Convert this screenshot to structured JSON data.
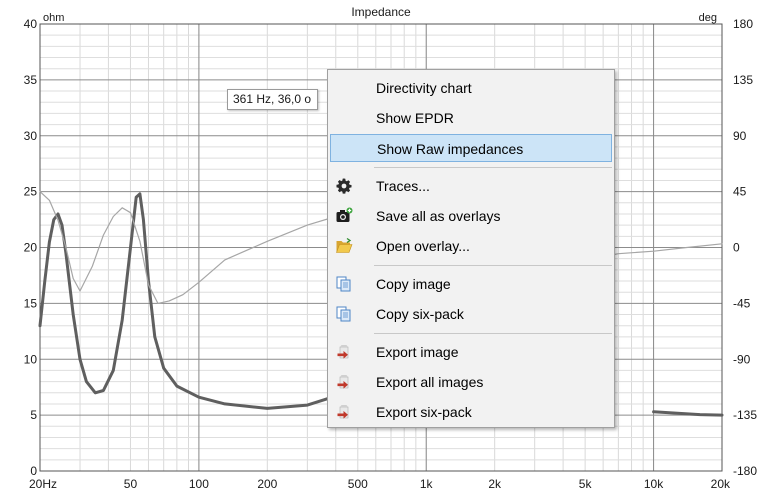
{
  "chart_data": {
    "type": "line",
    "title": "Impedance",
    "x_scale": "log",
    "xlim": [
      20,
      20000
    ],
    "x_ticks": [
      20,
      50,
      100,
      200,
      500,
      1000,
      2000,
      5000,
      10000,
      20000
    ],
    "x_tick_labels": [
      "20Hz",
      "50",
      "100",
      "200",
      "500",
      "1k",
      "2k",
      "5k",
      "10k",
      "20k"
    ],
    "left_axis": {
      "unit": "ohm",
      "ylim": [
        0,
        40
      ],
      "ticks": [
        0,
        5,
        10,
        15,
        20,
        25,
        30,
        35,
        40
      ]
    },
    "right_axis": {
      "unit": "deg",
      "ylim": [
        -180,
        180
      ],
      "ticks": [
        -180,
        -135,
        -90,
        -45,
        0,
        45,
        90,
        135,
        180
      ]
    },
    "grid": true,
    "series": [
      {
        "axis": "left",
        "color": "#5f5f5f",
        "x": [
          20,
          21,
          22,
          23,
          24,
          25,
          26,
          28,
          30,
          32,
          35,
          38,
          42,
          46,
          50,
          53,
          55,
          57,
          60,
          64,
          70,
          80,
          100,
          130,
          200,
          300,
          400
        ],
        "y": [
          13,
          17,
          20.5,
          22.5,
          23,
          22,
          19.5,
          14,
          10,
          8,
          7,
          7.2,
          9,
          13.5,
          20,
          24.5,
          24.8,
          22.5,
          17,
          12,
          9.2,
          7.6,
          6.6,
          6,
          5.6,
          5.9,
          6.7
        ]
      },
      {
        "axis": "left",
        "x": [
          10000,
          13000,
          16000,
          20000
        ],
        "y": [
          5.3,
          5.15,
          5.05,
          5.0
        ]
      },
      {
        "axis": "right",
        "color": "#a6a6a6",
        "x": [
          20,
          22,
          24,
          26,
          28,
          30,
          34,
          38,
          42,
          46,
          50,
          55,
          60,
          66,
          74,
          85,
          100,
          130,
          200,
          300,
          400
        ],
        "y": [
          45,
          38,
          22,
          0,
          -25,
          -35,
          -15,
          10,
          25,
          32,
          28,
          5,
          -30,
          -45,
          -43,
          -38,
          -28,
          -10,
          5,
          18,
          25
        ]
      },
      {
        "axis": "right",
        "x": [
          5000,
          7000,
          10000,
          14000,
          20000
        ],
        "y": [
          -10,
          -5,
          -3,
          0,
          3
        ]
      }
    ]
  },
  "tooltip": {
    "text": "361 Hz, 36,0 o"
  },
  "context_menu": {
    "groups": [
      [
        {
          "label": "Directivity chart",
          "icon": ""
        },
        {
          "label": "Show EPDR",
          "icon": ""
        },
        {
          "label": "Show Raw impedances",
          "icon": "",
          "highlighted": true
        }
      ],
      [
        {
          "label": "Traces...",
          "icon": "gear-icon"
        },
        {
          "label": "Save all as overlays",
          "icon": "camera-icon"
        },
        {
          "label": "Open overlay...",
          "icon": "folder-open-icon"
        }
      ],
      [
        {
          "label": "Copy image",
          "icon": "copy-icon"
        },
        {
          "label": "Copy six-pack",
          "icon": "copy-icon"
        }
      ],
      [
        {
          "label": "Export image",
          "icon": "export-icon"
        },
        {
          "label": "Export all images",
          "icon": "export-icon"
        },
        {
          "label": "Export six-pack",
          "icon": "export-icon"
        }
      ]
    ]
  }
}
